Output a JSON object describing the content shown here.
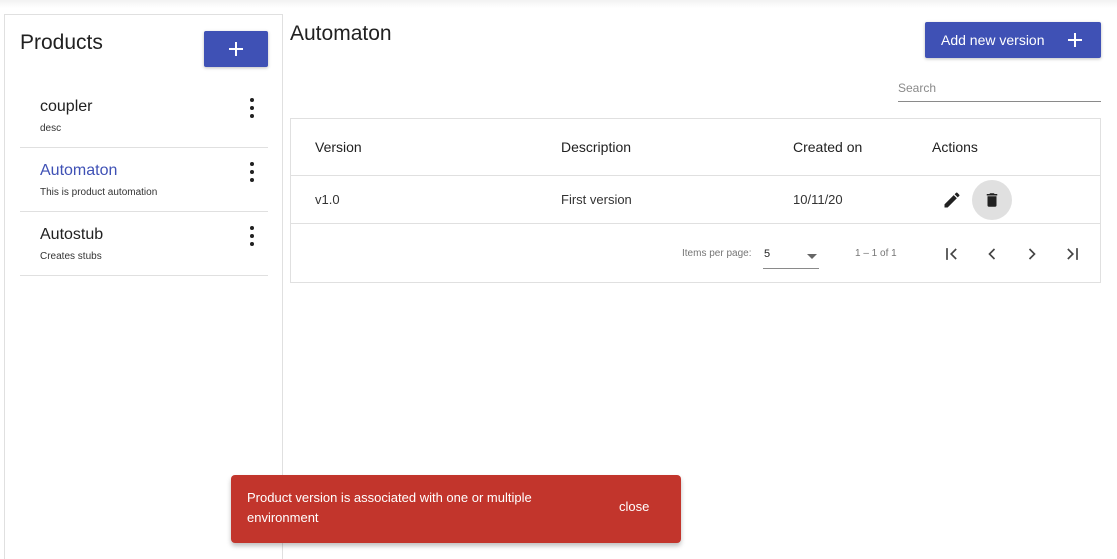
{
  "sidebar": {
    "title": "Products",
    "items": [
      {
        "name": "coupler",
        "desc": "desc",
        "active": false
      },
      {
        "name": "Automaton",
        "desc": "This is product automation",
        "active": true
      },
      {
        "name": "Autostub",
        "desc": "Creates stubs",
        "active": false
      }
    ]
  },
  "main": {
    "title": "Automaton",
    "add_version_label": "Add new version",
    "search_placeholder": "Search",
    "table": {
      "headers": {
        "version": "Version",
        "description": "Description",
        "created": "Created on",
        "actions": "Actions"
      },
      "rows": [
        {
          "version": "v1.0",
          "description": "First version",
          "created": "10/11/20"
        }
      ]
    },
    "paginator": {
      "items_per_page_label": "Items per page:",
      "page_size": "5",
      "range": "1 – 1 of 1"
    }
  },
  "snackbar": {
    "message": "Product version is associated with one or multiple environment",
    "action": "close"
  },
  "colors": {
    "primary": "#3f51b5",
    "error": "#c2352c"
  }
}
